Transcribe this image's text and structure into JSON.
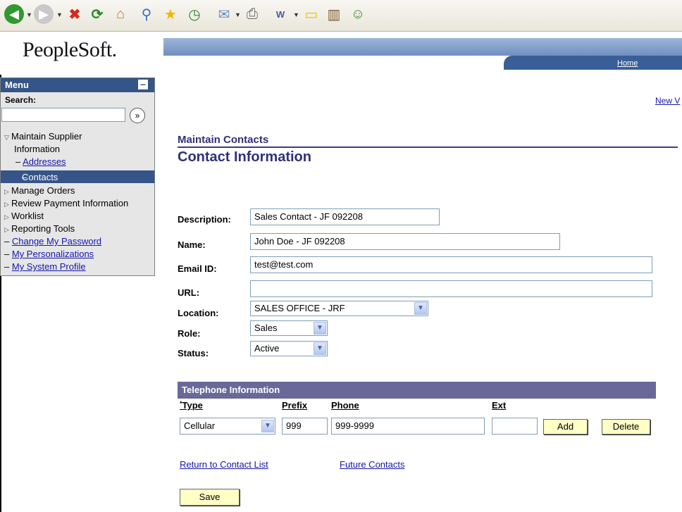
{
  "browser_toolbar": {
    "icons": [
      "back-icon",
      "forward-icon",
      "stop-icon",
      "refresh-icon",
      "home-icon",
      "search-icon",
      "favorites-icon",
      "history-icon",
      "mail-icon",
      "print-icon",
      "edit-icon",
      "discuss-icon",
      "research-icon",
      "messenger-icon"
    ]
  },
  "header": {
    "logo": "PeopleSoft.",
    "home_link": "Home"
  },
  "menu": {
    "title": "Menu",
    "collapse_symbol": "–",
    "search_label": "Search:",
    "search_value": "",
    "search_go": "»",
    "items": [
      {
        "label": "Maintain Supplier",
        "label2": "Information",
        "expanded": true
      },
      {
        "label": "Addresses",
        "prefix": "–"
      },
      {
        "label": "Contacts",
        "prefix": "–"
      },
      {
        "label": "Manage Orders"
      },
      {
        "label": "Review Payment Information"
      },
      {
        "label": "Worklist"
      },
      {
        "label": "Reporting Tools"
      },
      {
        "label": "Change My Password",
        "prefix": "–"
      },
      {
        "label": "My Personalizations",
        "prefix": "–"
      },
      {
        "label": "My System Profile",
        "prefix": "–"
      }
    ]
  },
  "top_link": "New V",
  "page": {
    "section_title": "Maintain Contacts",
    "title": "Contact Information"
  },
  "form": {
    "description_label": "Description:",
    "description_value": "Sales Contact - JF 092208",
    "name_label": "Name:",
    "name_value": "John Doe - JF 092208",
    "email_label": "Email ID:",
    "email_value": "test@test.com",
    "url_label": "URL:",
    "url_value": "",
    "location_label": "Location:",
    "location_value": "SALES OFFICE - JRF",
    "role_label": "Role:",
    "role_value": "Sales",
    "status_label": "Status:",
    "status_value": "Active"
  },
  "telephone": {
    "header": "Telephone Information",
    "required_mark": "*",
    "columns": [
      "Type",
      "Prefix",
      "Phone",
      "Ext"
    ],
    "row": {
      "type": "Cellular",
      "prefix": "999",
      "phone": "999-9999",
      "ext": ""
    },
    "add_label": "Add",
    "delete_label": "Delete"
  },
  "links": {
    "return": "Return to Contact List",
    "future": "Future Contacts"
  },
  "save_label": "Save",
  "colors": {
    "menu_header": "#355487",
    "title": "#30307a",
    "telephone_bar": "#6a6899",
    "button": "#ffffc6",
    "link": "#1515b0"
  }
}
